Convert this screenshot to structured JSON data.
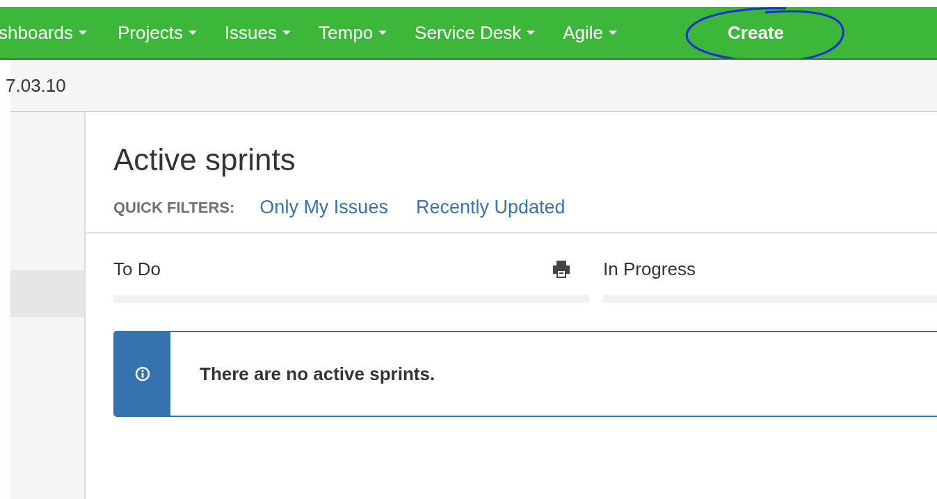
{
  "nav": {
    "items": [
      {
        "label": "shboards"
      },
      {
        "label": "Projects"
      },
      {
        "label": "Issues"
      },
      {
        "label": "Tempo"
      },
      {
        "label": "Service Desk"
      },
      {
        "label": "Agile"
      }
    ],
    "create": "Create"
  },
  "breadcrumb": "7.03.10",
  "sidebar": {
    "items": [
      {
        "selected": true
      }
    ]
  },
  "page": {
    "title": "Active sprints",
    "quick_filters_label": "QUICK FILTERS:",
    "quick_filters": [
      "Only My Issues",
      "Recently Updated"
    ]
  },
  "columns": [
    {
      "title": "To Do",
      "print": true
    },
    {
      "title": "In Progress",
      "print": false
    }
  ],
  "message": "There are no active sprints."
}
